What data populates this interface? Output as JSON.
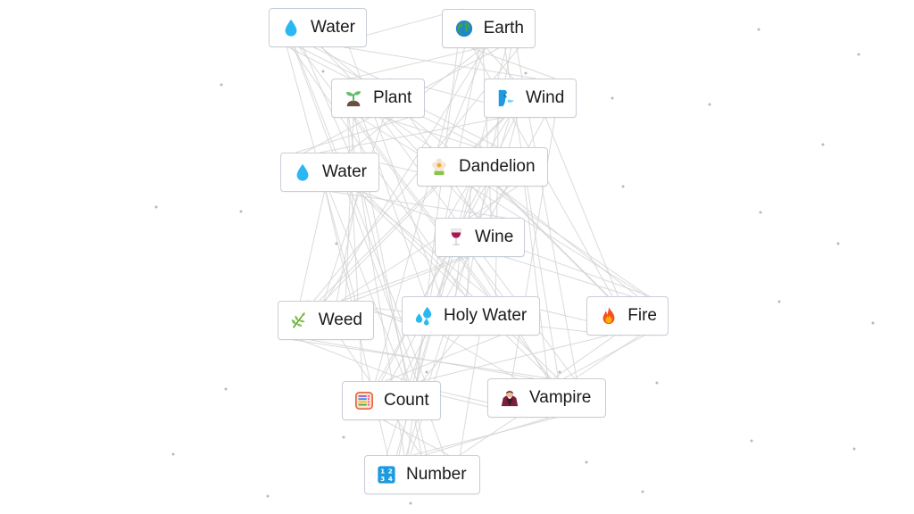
{
  "game": {
    "items": [
      {
        "id": "water-1",
        "label": "Water",
        "icon": "water-drop-icon"
      },
      {
        "id": "earth",
        "label": "Earth",
        "icon": "globe-icon"
      },
      {
        "id": "plant",
        "label": "Plant",
        "icon": "seedling-icon"
      },
      {
        "id": "wind",
        "label": "Wind",
        "icon": "wind-face-icon"
      },
      {
        "id": "water-2",
        "label": "Water",
        "icon": "water-drop-icon"
      },
      {
        "id": "dandelion",
        "label": "Dandelion",
        "icon": "flower-icon"
      },
      {
        "id": "wine",
        "label": "Wine",
        "icon": "wine-glass-icon"
      },
      {
        "id": "weed",
        "label": "Weed",
        "icon": "herb-icon"
      },
      {
        "id": "holy-water",
        "label": "Holy Water",
        "icon": "sweat-droplets-icon"
      },
      {
        "id": "fire",
        "label": "Fire",
        "icon": "fire-icon"
      },
      {
        "id": "count",
        "label": "Count",
        "icon": "abacus-icon"
      },
      {
        "id": "vampire",
        "label": "Vampire",
        "icon": "vampire-icon"
      },
      {
        "id": "number",
        "label": "Number",
        "icon": "input-numbers-icon"
      }
    ]
  }
}
